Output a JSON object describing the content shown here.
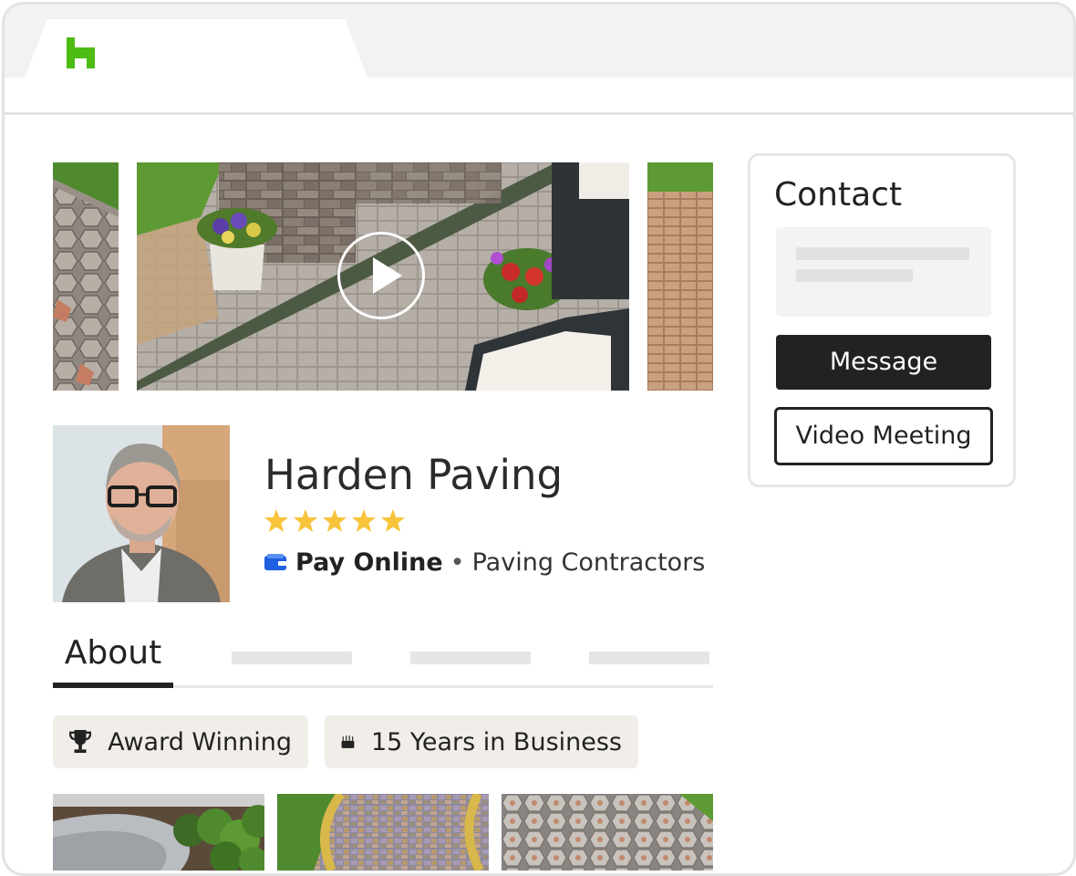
{
  "browser": {
    "tab_icon": "houzz-logo-icon"
  },
  "gallery": {
    "play_icon": "play-icon"
  },
  "profile": {
    "name": "Harden Paving",
    "rating": 5,
    "star_color": "#f7c43b",
    "payment_label": "Pay Online",
    "separator": "•",
    "category": "Paving Contractors"
  },
  "tabs": {
    "active": "About"
  },
  "badges": [
    {
      "icon": "trophy-icon",
      "label": "Award Winning"
    },
    {
      "icon": "cake-icon",
      "label": "15 Years in Business"
    }
  ],
  "contact": {
    "title": "Contact",
    "message_button": "Message",
    "video_button": "Video Meeting"
  },
  "colors": {
    "brand": "#4dbc15",
    "dark": "#222222"
  }
}
